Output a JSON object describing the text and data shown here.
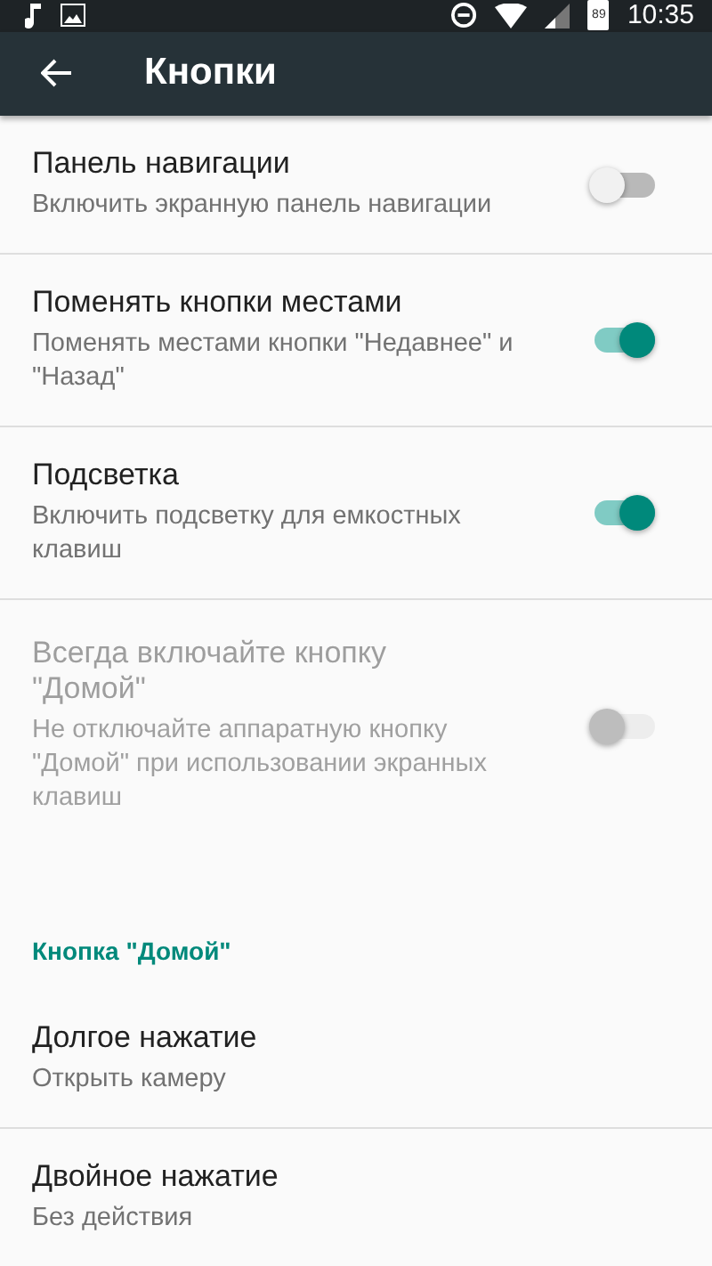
{
  "status_bar": {
    "battery": "89",
    "time": "10:35"
  },
  "app_bar": {
    "title": "Кнопки"
  },
  "items": [
    {
      "kind": "toggle",
      "title": "Панель навигации",
      "summary": "Включить экранную панель навигации",
      "on": false,
      "disabled": false
    },
    {
      "kind": "toggle",
      "title": "Поменять кнопки местами",
      "summary": "Поменять местами кнопки \"Недавнее\" и \"Назад\"",
      "on": true,
      "disabled": false
    },
    {
      "kind": "toggle",
      "title": "Подсветка",
      "summary": "Включить подсветку для емкостных клавиш",
      "on": true,
      "disabled": false
    },
    {
      "kind": "toggle",
      "title": "Всегда включайте кнопку \"Домой\"",
      "summary": "Не отключайте аппаратную кнопку \"Домой\" при использовании экранных клавиш",
      "on": false,
      "disabled": true
    },
    {
      "kind": "category",
      "title": "Кнопка \"Домой\""
    },
    {
      "kind": "action",
      "title": "Долгое нажатие",
      "summary": "Открыть камеру"
    },
    {
      "kind": "action",
      "title": "Двойное нажатие",
      "summary": "Без действия"
    }
  ]
}
